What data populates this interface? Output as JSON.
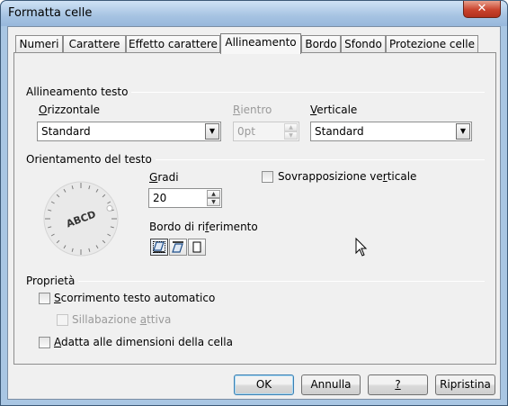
{
  "window": {
    "title": "Formatta celle",
    "close_glyph": "✕"
  },
  "tabs": [
    {
      "label": "Numeri"
    },
    {
      "label": "Carattere"
    },
    {
      "label": "Effetto carattere"
    },
    {
      "label": "Allineamento",
      "active": true
    },
    {
      "label": "Bordo"
    },
    {
      "label": "Sfondo"
    },
    {
      "label": "Protezione celle"
    }
  ],
  "alignment": {
    "section_title": "Allineamento testo",
    "horizontal": {
      "label_accel": "O",
      "label_rest": "rizzontale",
      "value": "Standard"
    },
    "indent": {
      "label_accel": "R",
      "label_rest": "ientro",
      "value": "0pt",
      "disabled": true
    },
    "vertical": {
      "label_accel": "V",
      "label_rest": "erticale",
      "value": "Standard"
    }
  },
  "orientation": {
    "section_title": "Orientamento del testo",
    "dial_text": "ABCD",
    "degrees": {
      "label_accel": "G",
      "label_rest": "radi",
      "value": "20"
    },
    "vertical_stack": {
      "label_pre": "Sovrapposizione ve",
      "label_accel": "r",
      "label_post": "ticale",
      "checked": false
    },
    "reference_edge": {
      "label_pre": "Bordo di ri",
      "label_accel": "f",
      "label_post": "erimento"
    }
  },
  "properties": {
    "section_title": "Proprietà",
    "wrap_text": {
      "label_accel": "S",
      "label_rest": "corrimento testo automatico",
      "checked": false
    },
    "hyphenation": {
      "label_pre": "Sillabazione ",
      "label_accel": "a",
      "label_post": "ttiva",
      "checked": false,
      "disabled": true
    },
    "shrink_to_fit": {
      "label_accel": "A",
      "label_rest": "datta alle dimensioni della cella",
      "checked": false
    }
  },
  "buttons": {
    "ok": "OK",
    "cancel": "Annulla",
    "help": "?",
    "reset": "Ripristina"
  },
  "colors": {
    "frame": "#a9c6e3",
    "dialog_bg": "#f0f0f0",
    "close_red": "#c9432d",
    "default_button_border": "#3c7fb1"
  }
}
